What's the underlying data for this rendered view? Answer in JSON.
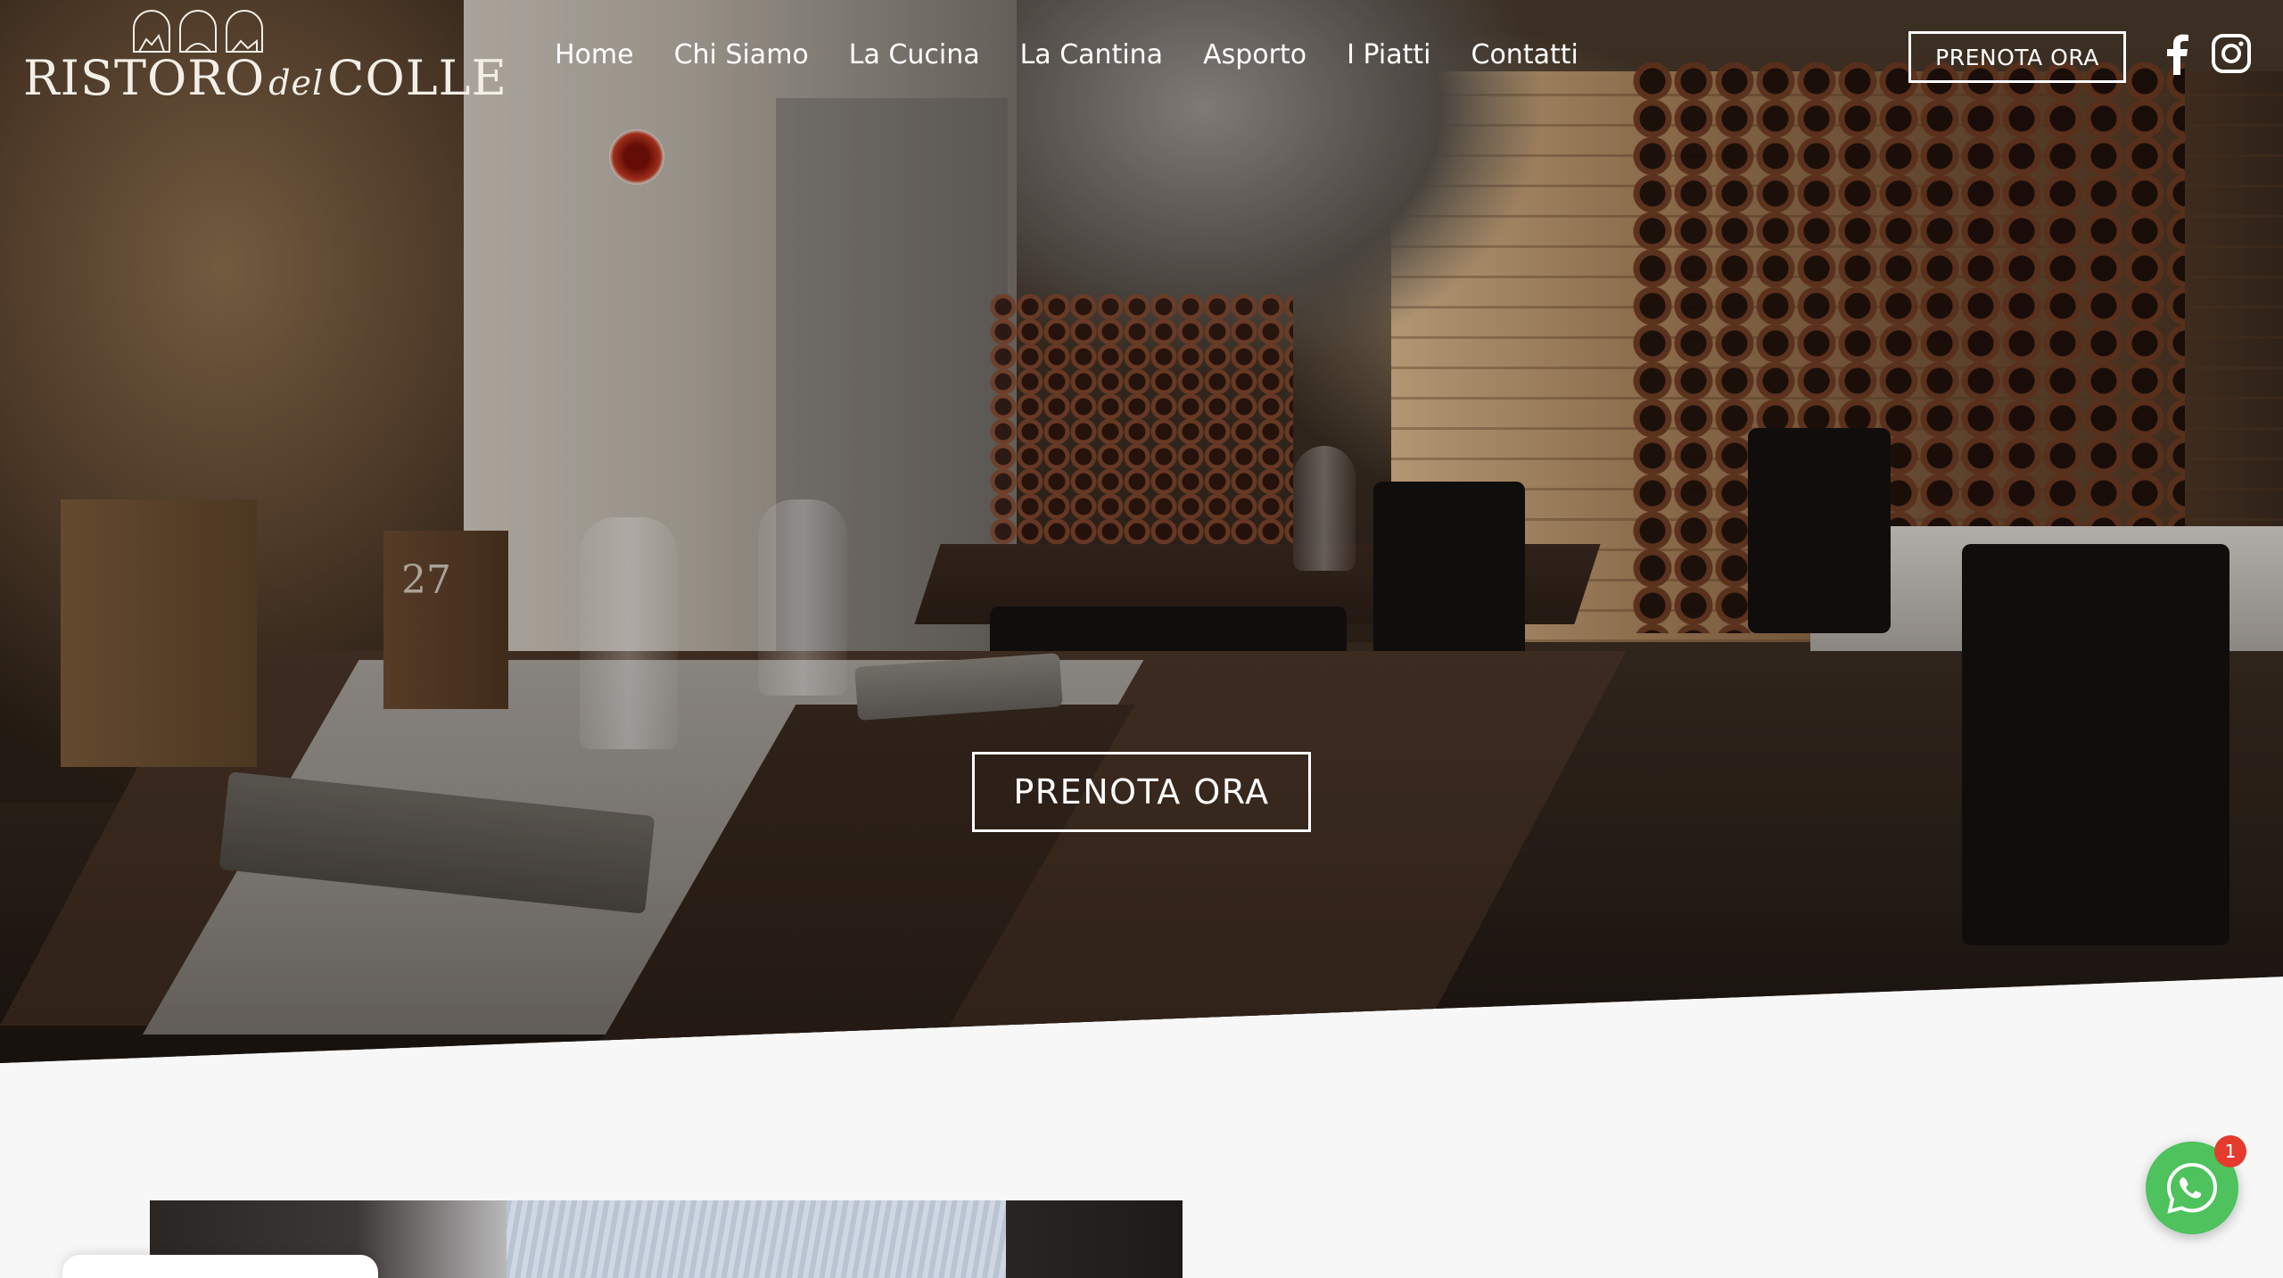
{
  "brand": {
    "name_part1": "RISTORO",
    "name_part2": "del",
    "name_part3": "COLLE"
  },
  "nav": {
    "items": [
      {
        "label": "Home"
      },
      {
        "label": "Chi Siamo"
      },
      {
        "label": "La Cucina"
      },
      {
        "label": "La Cantina"
      },
      {
        "label": "Asporto"
      },
      {
        "label": "I Piatti"
      },
      {
        "label": "Contatti"
      }
    ]
  },
  "header": {
    "cta_label": "PRENOTA ORA"
  },
  "social": {
    "facebook_icon": "facebook-icon",
    "instagram_icon": "instagram-icon"
  },
  "hero": {
    "cta_label": "PRENOTA ORA",
    "table_number": "27"
  },
  "whatsapp": {
    "icon": "whatsapp-icon",
    "badge_count": "1",
    "color": "#4dc25d",
    "badge_color": "#e43b2c"
  },
  "colors": {
    "background": "#f7f7f7",
    "text_light": "#ffffff"
  }
}
